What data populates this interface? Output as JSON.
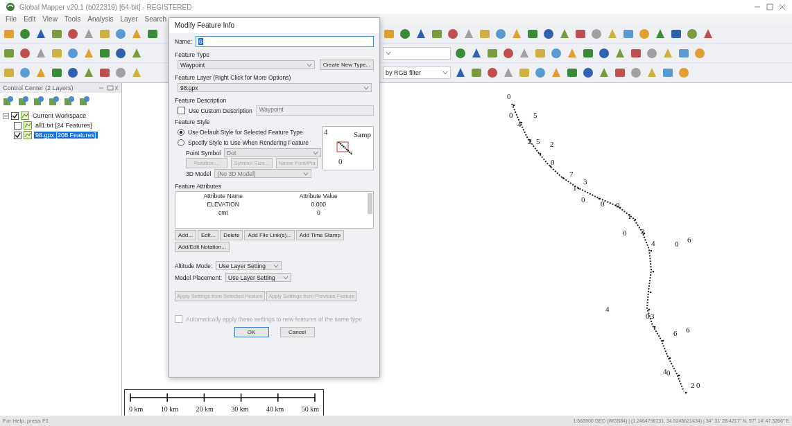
{
  "window": {
    "title": "Global Mapper v20.1 (b022319) [64-bit] - REGISTERED"
  },
  "menu": [
    "File",
    "Edit",
    "View",
    "Tools",
    "Analysis",
    "Layer",
    "Search"
  ],
  "toolbar_filter": {
    "value": "by RGB filter"
  },
  "control_center": {
    "title": "Control Center (2 Layers)",
    "tree": [
      {
        "label": "Current Workspace",
        "checked": true,
        "selected": false,
        "children": [
          {
            "label": "all1.txt [24 Features]",
            "checked": false,
            "selected": false
          },
          {
            "label": "98.gpx [208 Features]",
            "checked": true,
            "selected": true
          }
        ]
      }
    ]
  },
  "map_labels": [
    "0",
    "0",
    "4",
    "5",
    "2",
    "5",
    "2",
    "0",
    "7",
    "3",
    "1",
    "0",
    "0",
    "0",
    "1",
    "0",
    "3",
    "4",
    "0",
    "6",
    "4",
    "0",
    "3",
    "6",
    "6",
    "4",
    "0",
    "2",
    "0"
  ],
  "scale_bar": [
    "0 km",
    "10 km",
    "20 km",
    "30 km",
    "40 km",
    "50 km"
  ],
  "dialog": {
    "title": "Modify Feature Info",
    "name": {
      "label": "Name:",
      "value": "6"
    },
    "feature_type": {
      "label": "Feature Type",
      "value": "Waypoint",
      "button": "Create New Type..."
    },
    "feature_layer": {
      "label": "Feature Layer (Right Click for More Options)",
      "value": "98.gpx"
    },
    "feature_description": {
      "label": "Feature Description",
      "checkbox": "Use Custom Description",
      "checked": false,
      "value": "Waypoint"
    },
    "feature_style": {
      "label": "Feature Style",
      "options": [
        {
          "label": "Use Default Style for Selected Feature Type",
          "selected": true
        },
        {
          "label": "Specify Style to Use When Rendering Feature",
          "selected": false
        }
      ],
      "point_symbol": {
        "label": "Point Symbol",
        "value": "Dot",
        "disabled": true
      },
      "buttons": [
        {
          "label": "Rotation...",
          "disabled": true
        },
        {
          "label": "Symbol Size...",
          "disabled": true
        },
        {
          "label": "Name Font/Pla",
          "disabled": true
        }
      ],
      "model": {
        "label": "3D Model",
        "value": "(No 3D Model)",
        "disabled": true
      },
      "preview": [
        "4",
        "Samp",
        "0"
      ]
    },
    "attributes": {
      "label": "Feature Attributes",
      "columns": [
        "Attribute Name",
        "Attribute Value"
      ],
      "rows": [
        [
          "ELEVATION",
          "0.000"
        ],
        [
          "cmt",
          "0"
        ]
      ],
      "buttons": [
        "Add...",
        "Edit...",
        "Delete",
        "Add File Link(s)...",
        "Add Time Stamp"
      ],
      "notation_button": "Add/Edit Notation..."
    },
    "altitude_mode": {
      "label": "Altitude Mode:",
      "value": "Use Layer Setting"
    },
    "model_placement": {
      "label": "Model Placement:",
      "value": "Use Layer Setting"
    },
    "apply_buttons": [
      {
        "label": "Apply Settings from Selected Feature",
        "disabled": true
      },
      {
        "label": "Apply Settings from Previous Feature",
        "disabled": true
      }
    ],
    "auto_apply": {
      "label": "Automatically apply these settings to new features of the same type",
      "checked": false,
      "disabled": true
    },
    "ok": "OK",
    "cancel": "Cancel"
  },
  "status_bar": {
    "help": "For Help, press F1",
    "info": "1:563900  GEO (WGS84) | (1.2464796131, 34.5245621434) | 34° 31' 28.4217\" N, 57° 14' 47.3266\" E"
  }
}
